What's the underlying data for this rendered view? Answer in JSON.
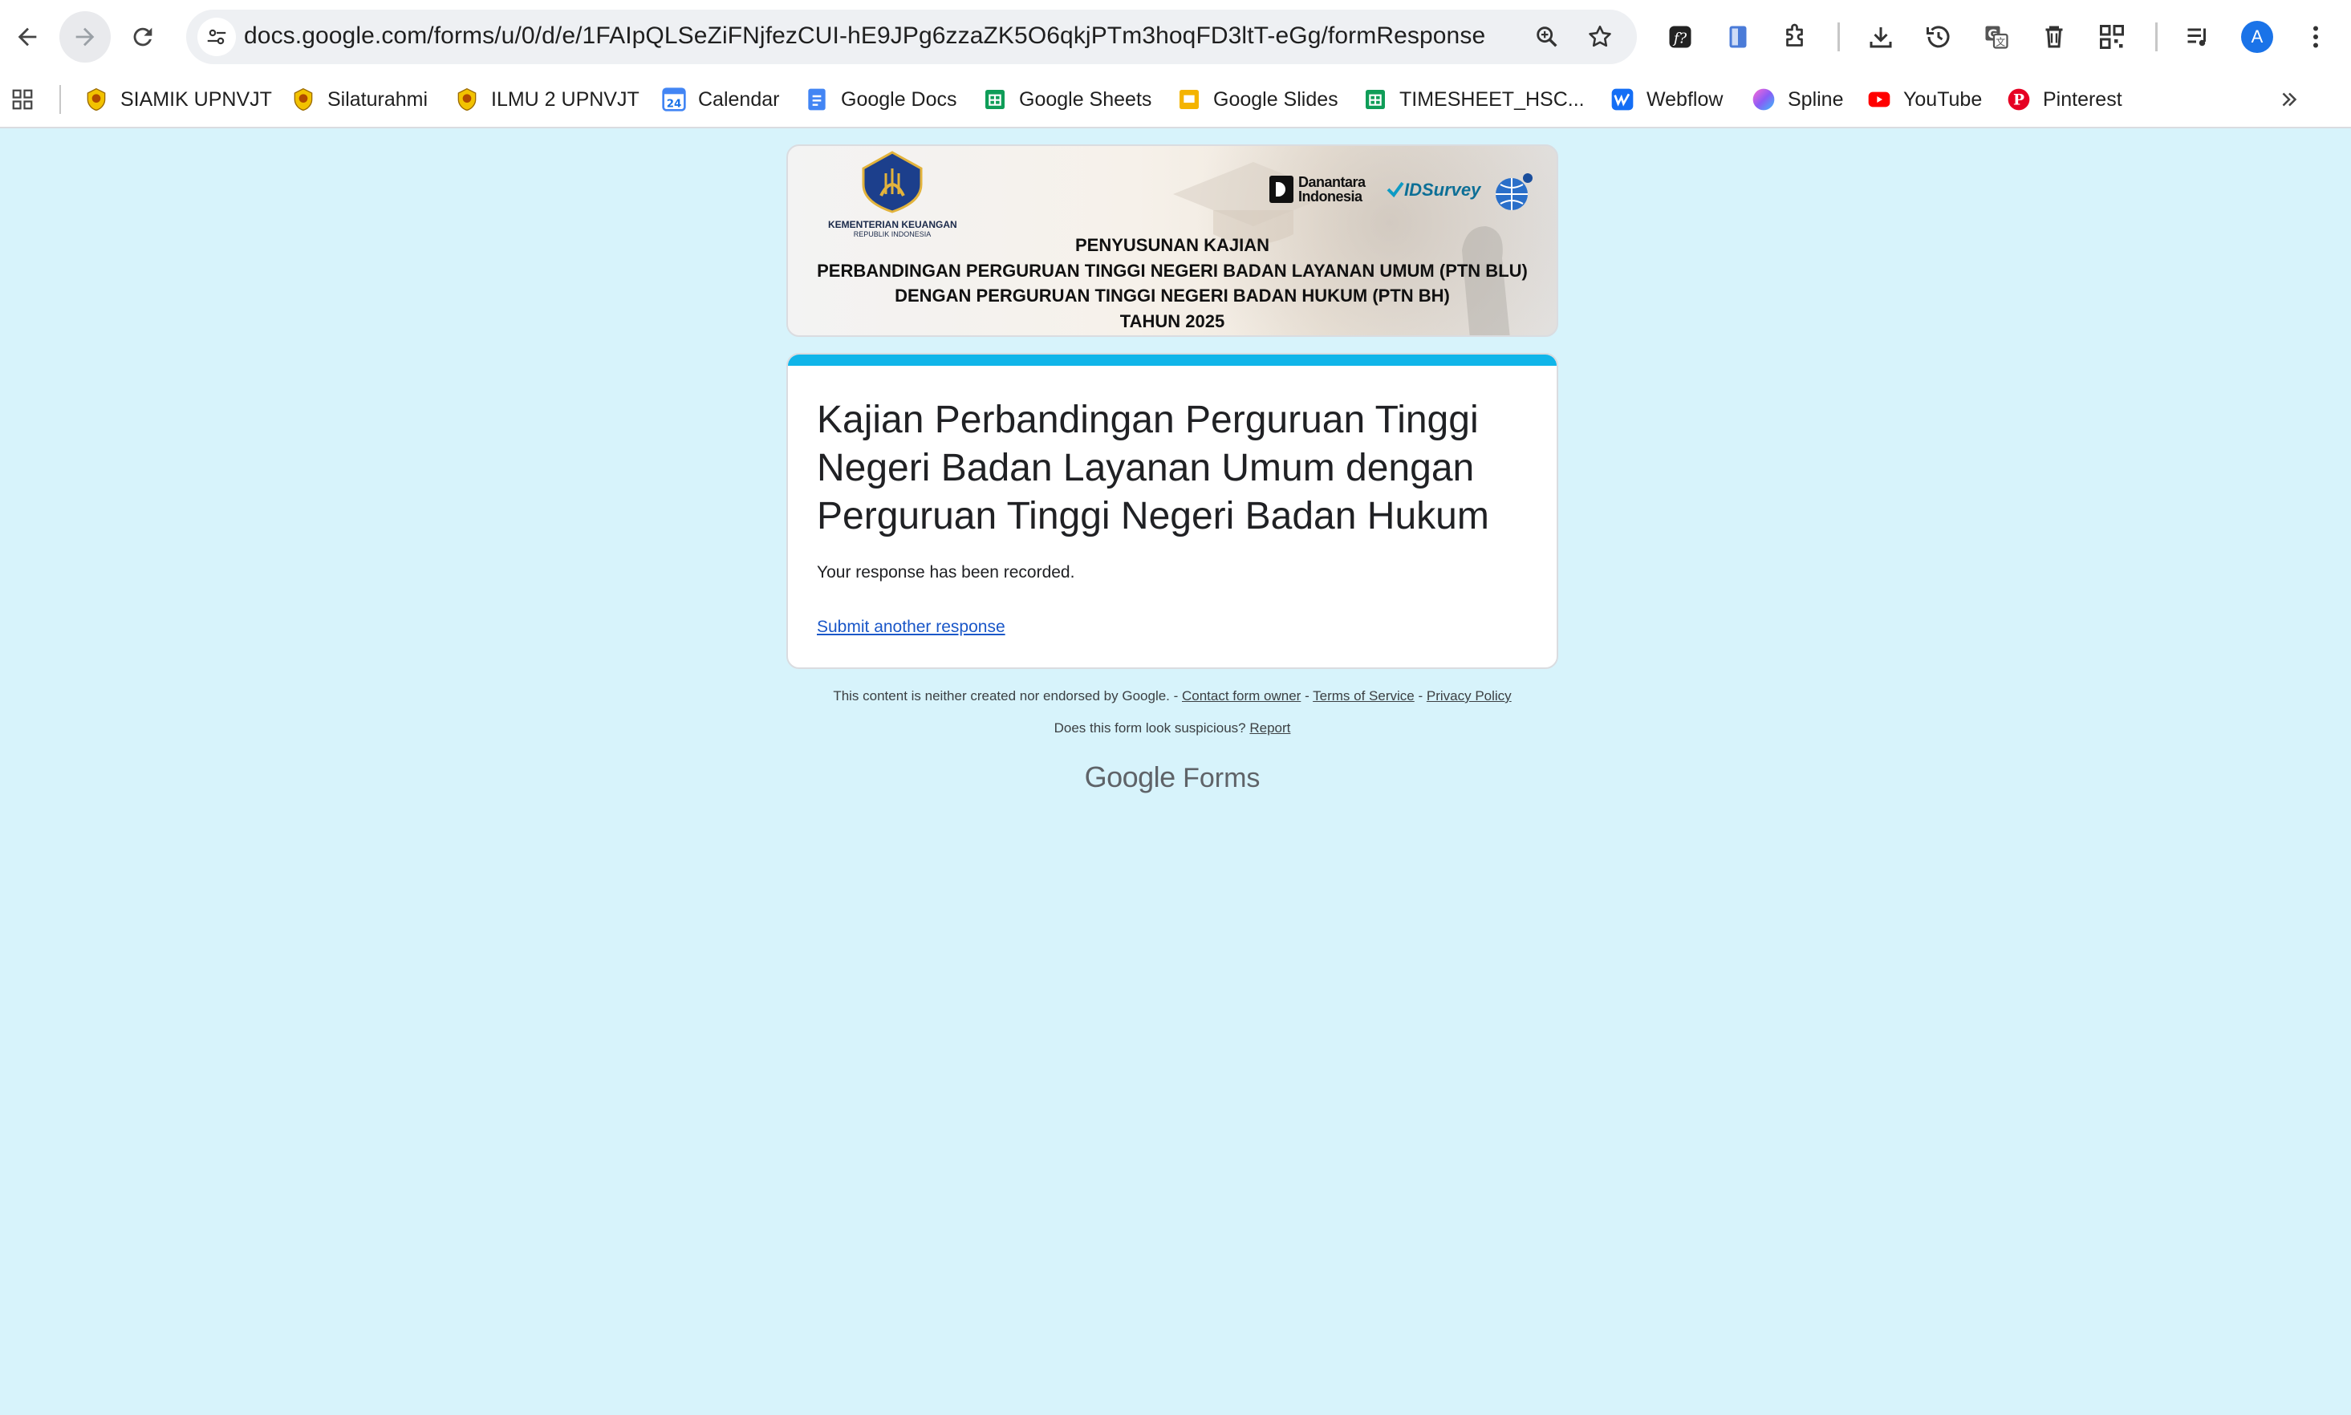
{
  "browser": {
    "url": "docs.google.com/forms/u/0/d/e/1FAIpQLSeZiFNjfezCUI-hE9JPg6zzaZK5O6qkjPTm3hoqFD3ltT-eGg/formResponse",
    "profile_initial": "A"
  },
  "bookmarks": [
    {
      "label": "SIAMIK UPNVJT",
      "icon": "upn-logo-icon"
    },
    {
      "label": "Silaturahmi",
      "icon": "upn-logo-icon"
    },
    {
      "label": "ILMU 2 UPNVJT",
      "icon": "upn-logo-icon"
    },
    {
      "label": "Calendar",
      "icon": "calendar-icon",
      "icon_text": "24"
    },
    {
      "label": "Google Docs",
      "icon": "docs-icon"
    },
    {
      "label": "Google Sheets",
      "icon": "sheets-icon"
    },
    {
      "label": "Google Slides",
      "icon": "slides-icon"
    },
    {
      "label": "TIMESHEET_HSC...",
      "icon": "sheets-icon"
    },
    {
      "label": "Webflow",
      "icon": "webflow-icon"
    },
    {
      "label": "Spline",
      "icon": "spline-icon"
    },
    {
      "label": "YouTube",
      "icon": "youtube-icon"
    },
    {
      "label": "Pinterest",
      "icon": "pinterest-icon"
    }
  ],
  "banner": {
    "org_name": "KEMENTERIAN KEUANGAN",
    "org_sub": "REPUBLIK INDONESIA",
    "partner1_line1": "Danantara",
    "partner1_line2": "Indonesia",
    "partner2": "IDSurvey",
    "lines": [
      "PENYUSUNAN KAJIAN",
      "PERBANDINGAN PERGURUAN TINGGI NEGERI BADAN LAYANAN UMUM (PTN BLU)",
      "DENGAN PERGURUAN TINGGI NEGERI BADAN HUKUM (PTN BH)",
      "TAHUN 2025"
    ]
  },
  "form": {
    "title": "Kajian Perbandingan Perguruan Tinggi Negeri Badan Layanan Umum dengan Perguruan Tinggi Negeri Badan Hukum",
    "confirmation": "Your response has been recorded.",
    "submit_another": "Submit another response"
  },
  "footer": {
    "disclaimer": "This content is neither created nor endorsed by Google. - ",
    "contact": "Contact form owner",
    "sep": " - ",
    "terms": "Terms of Service",
    "privacy": "Privacy Policy",
    "suspicious": "Does this form look suspicious? ",
    "report": "Report",
    "brand_google": "Google",
    "brand_forms": "Forms"
  },
  "colors": {
    "page_bg": "#d7f3fb",
    "accent": "#10b5e9",
    "link": "#1a57c8"
  }
}
